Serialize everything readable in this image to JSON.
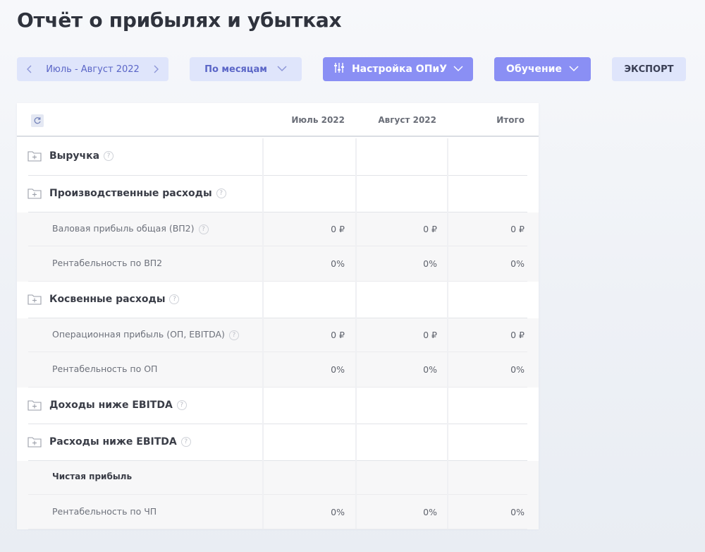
{
  "page": {
    "title": "Отчёт о прибылях и убытках"
  },
  "toolbar": {
    "period_label": "Июль - Август 2022",
    "grouping_label": "По месяцам",
    "settings_label": "Настройка ОПиУ",
    "learning_label": "Обучение",
    "export_label": "ЭКСПОРТ",
    "accent_color": "#8a8ff4",
    "soft_color": "#dfe5fb"
  },
  "table": {
    "columns": [
      "Июль 2022",
      "Август 2022",
      "Итого"
    ],
    "rows": [
      {
        "type": "group",
        "label": "Выручка",
        "help": "?",
        "values": [
          "",
          "",
          ""
        ]
      },
      {
        "type": "group",
        "label": "Производственные расходы",
        "help": "?",
        "values": [
          "",
          "",
          ""
        ]
      },
      {
        "type": "sub",
        "label": "Валовая прибыль общая (ВП2)",
        "help": "?",
        "values": [
          "0 ₽",
          "0 ₽",
          "0 ₽"
        ]
      },
      {
        "type": "sub",
        "label": "Рентабельность по ВП2",
        "values": [
          "0%",
          "0%",
          "0%"
        ]
      },
      {
        "type": "group",
        "label": "Косвенные расходы",
        "help": "?",
        "values": [
          "",
          "",
          ""
        ]
      },
      {
        "type": "sub",
        "label": "Операционная прибыль (ОП, EBITDA)",
        "help": "?",
        "values": [
          "0 ₽",
          "0 ₽",
          "0 ₽"
        ]
      },
      {
        "type": "sub",
        "label": "Рентабельность по ОП",
        "values": [
          "0%",
          "0%",
          "0%"
        ]
      },
      {
        "type": "group",
        "label": "Доходы ниже EBITDA",
        "help": "?",
        "values": [
          "",
          "",
          ""
        ]
      },
      {
        "type": "group",
        "label": "Расходы ниже EBITDA",
        "help": "?",
        "values": [
          "",
          "",
          ""
        ]
      },
      {
        "type": "sub",
        "label": "Чистая прибыль",
        "values": [
          "",
          "",
          ""
        ]
      },
      {
        "type": "sub",
        "label": "Рентабельность по ЧП",
        "values": [
          "0%",
          "0%",
          "0%"
        ]
      }
    ]
  }
}
